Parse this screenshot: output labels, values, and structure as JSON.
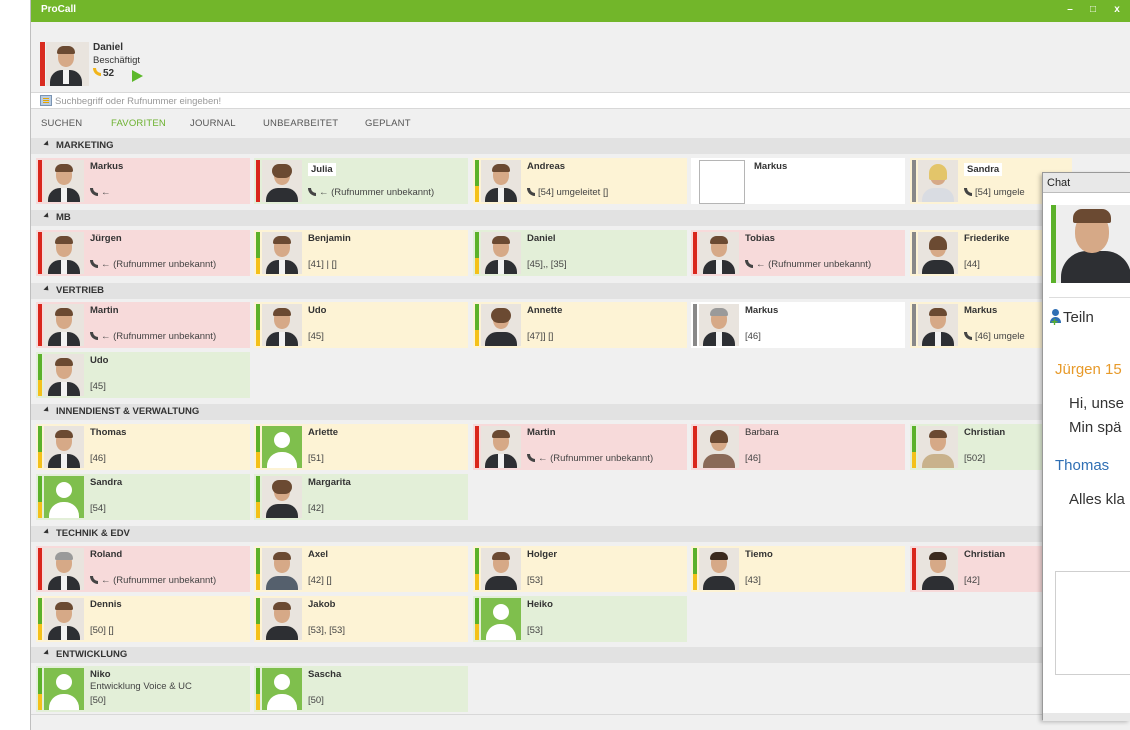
{
  "app": {
    "title": "ProCall",
    "minimize": "–",
    "maximize": "□",
    "close": "x"
  },
  "me": {
    "name": "Daniel",
    "status": "Beschäftigt",
    "extension": "52"
  },
  "search": {
    "placeholder": "Suchbegriff oder Rufnummer eingeben!"
  },
  "tabs": [
    "SUCHEN",
    "FAVORITEN",
    "JOURNAL",
    "UNBEARBEITET",
    "GEPLANT"
  ],
  "groups": [
    {
      "title": "MARKETING",
      "contacts": [
        {
          "name": "Markus",
          "info": "←"
        },
        {
          "name": "Julia",
          "info": "← (Rufnummer unbekannt)"
        },
        {
          "name": "Andreas",
          "info": "[54]  umgeleitet []"
        },
        {
          "name": "Markus",
          "info": ""
        },
        {
          "name": "Sandra",
          "info": "[54] umgele"
        }
      ]
    },
    {
      "title": "MB",
      "contacts": [
        {
          "name": "Jürgen",
          "info": "← (Rufnummer unbekannt)"
        },
        {
          "name": "Benjamin",
          "info": "[41] | []"
        },
        {
          "name": "Daniel",
          "info": "[45],, [35]"
        },
        {
          "name": "Tobias",
          "info": "← (Rufnummer unbekannt)"
        },
        {
          "name": "Friederike",
          "info": "[44]"
        }
      ]
    },
    {
      "title": "VERTRIEB",
      "contacts": [
        {
          "name": "Martin",
          "info": "← (Rufnummer unbekannt)"
        },
        {
          "name": "Udo",
          "info": "[45]"
        },
        {
          "name": "Annette",
          "info": "[47]] []"
        },
        {
          "name": "Markus",
          "info": "[46]"
        },
        {
          "name": "Markus",
          "info": "[46] umgele"
        },
        {
          "name": "Udo",
          "info": "[45]"
        }
      ]
    },
    {
      "title": "INNENDIENST & VERWALTUNG",
      "contacts": [
        {
          "name": "Thomas",
          "info": "[46]"
        },
        {
          "name": "Arlette",
          "info": "[51]"
        },
        {
          "name": "Martin",
          "info": "← (Rufnummer unbekannt)"
        },
        {
          "name": "Barbara",
          "info": "[46]"
        },
        {
          "name": "Christian",
          "info": "[502]"
        },
        {
          "name": "Sandra",
          "info": "[54]"
        },
        {
          "name": "Margarita",
          "info": "[42]"
        }
      ]
    },
    {
      "title": "TECHNIK & EDV",
      "contacts": [
        {
          "name": "Roland",
          "info": "← (Rufnummer unbekannt)"
        },
        {
          "name": "Axel",
          "info": "[42] []"
        },
        {
          "name": "Holger",
          "info": "[53]"
        },
        {
          "name": "Tiemo",
          "info": "[43]"
        },
        {
          "name": "Christian",
          "info": "[42]"
        },
        {
          "name": "Dennis",
          "info": "[50] []"
        },
        {
          "name": "Jakob",
          "info": "[53], [53]"
        },
        {
          "name": "Heiko",
          "info": "[53]"
        }
      ]
    },
    {
      "title": "ENTWICKLUNG",
      "contacts": [
        {
          "name": "Niko",
          "dept": "Entwicklung Voice & UC",
          "info": "[50]"
        },
        {
          "name": "Sascha",
          "info": "[50]"
        }
      ]
    }
  ],
  "chat": {
    "title": "Chat",
    "add_label": "Teiln",
    "msg1_sender": "Jürgen 15",
    "msg1_line1": "Hi, unse",
    "msg1_line2": "Min spä",
    "msg2_sender": "Thomas",
    "msg2_line1": "Alles kla"
  },
  "colors": {
    "accent_green": "#72b62a",
    "status_red": "#d9261c",
    "status_green": "#5bb12a",
    "status_yellow": "#f4c11a"
  }
}
